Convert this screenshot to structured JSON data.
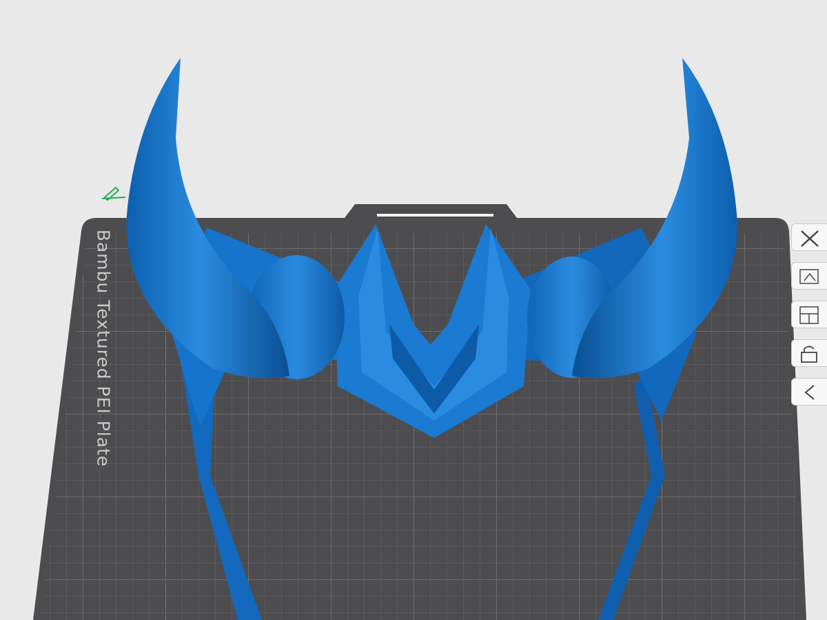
{
  "viewport": {
    "plate_name": "Bambu Textured PEI Plate",
    "model_color": "#1574c9",
    "plate_color": "#4d4d4f",
    "background_color": "#e9e9ea"
  },
  "toolbar": {
    "buttons": [
      {
        "icon": "close-icon"
      },
      {
        "icon": "auto-orient-icon"
      },
      {
        "icon": "arrange-icon"
      },
      {
        "icon": "lock-icon"
      },
      {
        "icon": "collapse-icon"
      }
    ]
  },
  "plate_edit": {
    "icon": "pencil-icon"
  }
}
